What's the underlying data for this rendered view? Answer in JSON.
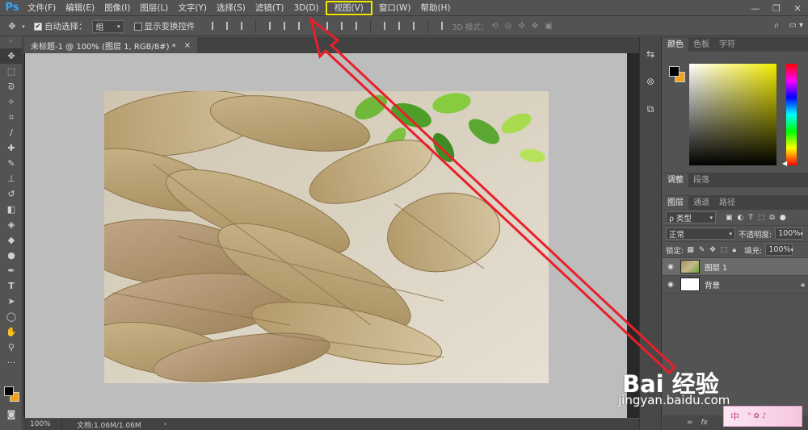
{
  "app": {
    "logo": "Ps"
  },
  "menu": {
    "items": [
      {
        "label": "文件(F)"
      },
      {
        "label": "编辑(E)"
      },
      {
        "label": "图像(I)"
      },
      {
        "label": "图层(L)"
      },
      {
        "label": "文字(Y)"
      },
      {
        "label": "选择(S)"
      },
      {
        "label": "滤镜(T)"
      },
      {
        "label": "3D(D)"
      },
      {
        "label": "视图(V)",
        "highlighted": true
      },
      {
        "label": "窗口(W)"
      },
      {
        "label": "帮助(H)"
      }
    ],
    "highlight_color": "#f4e400"
  },
  "options": {
    "auto_select_label": "自动选择：",
    "auto_select_checked": true,
    "auto_select_value": "组",
    "show_transform_label": "显示变换控件",
    "show_transform_checked": false,
    "mode_3d_label": "3D 模式："
  },
  "document": {
    "tab_title": "未标题-1 @ 100% (图层 1, RGB/8#) *",
    "close_icon": "×",
    "zoom": "100%",
    "doc_info": "文档:1.06M/1.06M"
  },
  "panels": {
    "color_tabs": [
      "颜色",
      "色板",
      "字符"
    ],
    "adjust_tabs": [
      "调整",
      "段落"
    ],
    "layers_tabs": [
      "图层",
      "通道",
      "路径"
    ],
    "kind_filter": "ρ 类型",
    "blend_mode": "正常",
    "opacity_label": "不透明度:",
    "opacity_value": "100%",
    "lock_label": "锁定:",
    "fill_label": "填充:",
    "fill_value": "100%",
    "layers": [
      {
        "name": "图层 1",
        "selected": true,
        "thumb": "photo"
      },
      {
        "name": "背景",
        "selected": false,
        "thumb": "white",
        "locked": true
      }
    ],
    "fg_color": "#000000",
    "bg_color": "#f4a11a"
  },
  "watermark": {
    "brand": "Bai 经验",
    "url": "jingyan.baidu.com"
  },
  "ime": {
    "label": "中"
  },
  "annotation": {
    "arrow_color": "#e8202a"
  }
}
